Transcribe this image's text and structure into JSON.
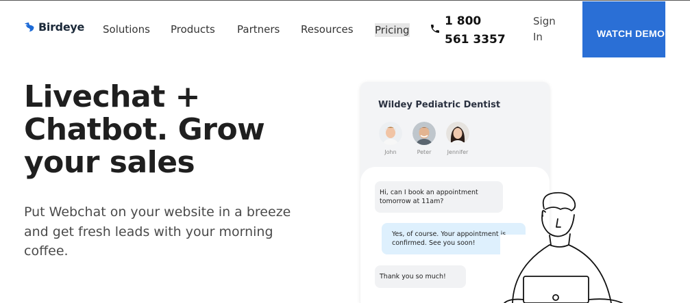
{
  "header": {
    "brand": "Birdeye",
    "nav": [
      "Solutions",
      "Products",
      "Partners",
      "Resources",
      "Pricing"
    ],
    "phone": "1 800 561 3357",
    "signin": "Sign In",
    "demo": "WATCH DEMO"
  },
  "hero": {
    "title": "Livechat + Chatbot. Grow your sales",
    "subtitle": "Put Webchat on your website in a breeze and get fresh leads with your morning coffee."
  },
  "chat": {
    "business": "Wildey Pediatric Dentist",
    "agents": [
      "John",
      "Peter",
      "Jennifer"
    ],
    "messages": [
      "Hi, can I book an appointment tomorrow at 11am?",
      "Yes, of course. Your appointment is confirmed. See you soon!",
      "Thank you so much!"
    ]
  },
  "colors": {
    "accent": "#2a6fd6",
    "bubble_agent": "#def0fd",
    "bubble_user": "#f1f2f4"
  },
  "icons": [
    "birdeye-logo-icon",
    "phone-icon"
  ]
}
